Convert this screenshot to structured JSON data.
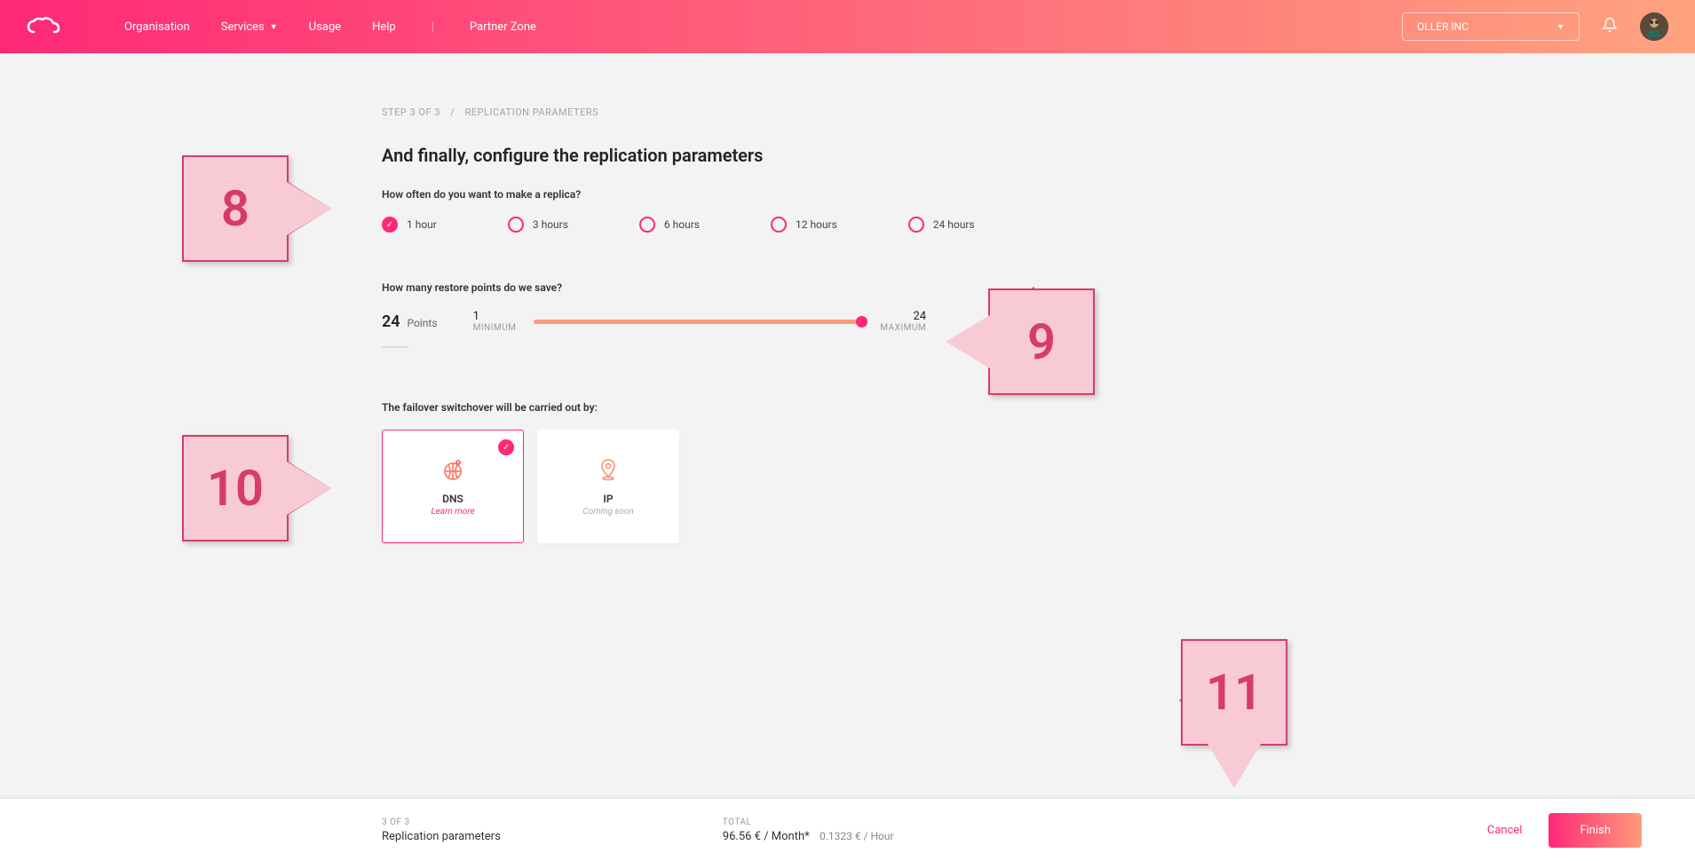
{
  "nav": {
    "items": [
      "Organisation",
      "Services",
      "Usage",
      "Help",
      "Partner Zone"
    ],
    "org": "OLLER INC"
  },
  "breadcrumb": {
    "step": "STEP 3 OF 3",
    "title": "REPLICATION PARAMETERS"
  },
  "page_title": "And finally, configure the replication parameters",
  "replica_freq": {
    "label": "How often do you want to make a replica?",
    "options": [
      "1 hour",
      "3 hours",
      "6 hours",
      "12 hours",
      "24 hours"
    ],
    "selected_index": 0
  },
  "restore_points": {
    "label": "How many restore points do we save?",
    "value": "24",
    "unit": "Points",
    "min_value": "1",
    "min_label": "MINIMUM",
    "max_value": "24",
    "max_label": "MAXIMUM"
  },
  "failover": {
    "label": "The failover switchover will be carried out by:",
    "cards": [
      {
        "title": "DNS",
        "sub": "Learn more",
        "selected": true
      },
      {
        "title": "IP",
        "sub": "Coming soon",
        "selected": false
      }
    ]
  },
  "footer": {
    "step_count": "3 OF 3",
    "step_name": "Replication parameters",
    "total_label": "TOTAL",
    "price_month": "96.56 € / Month*",
    "price_hour": "0.1323 € / Hour",
    "cancel": "Cancel",
    "finish": "Finish"
  },
  "callouts": {
    "c8": "8",
    "c9": "9",
    "c10": "10",
    "c11": "11"
  }
}
